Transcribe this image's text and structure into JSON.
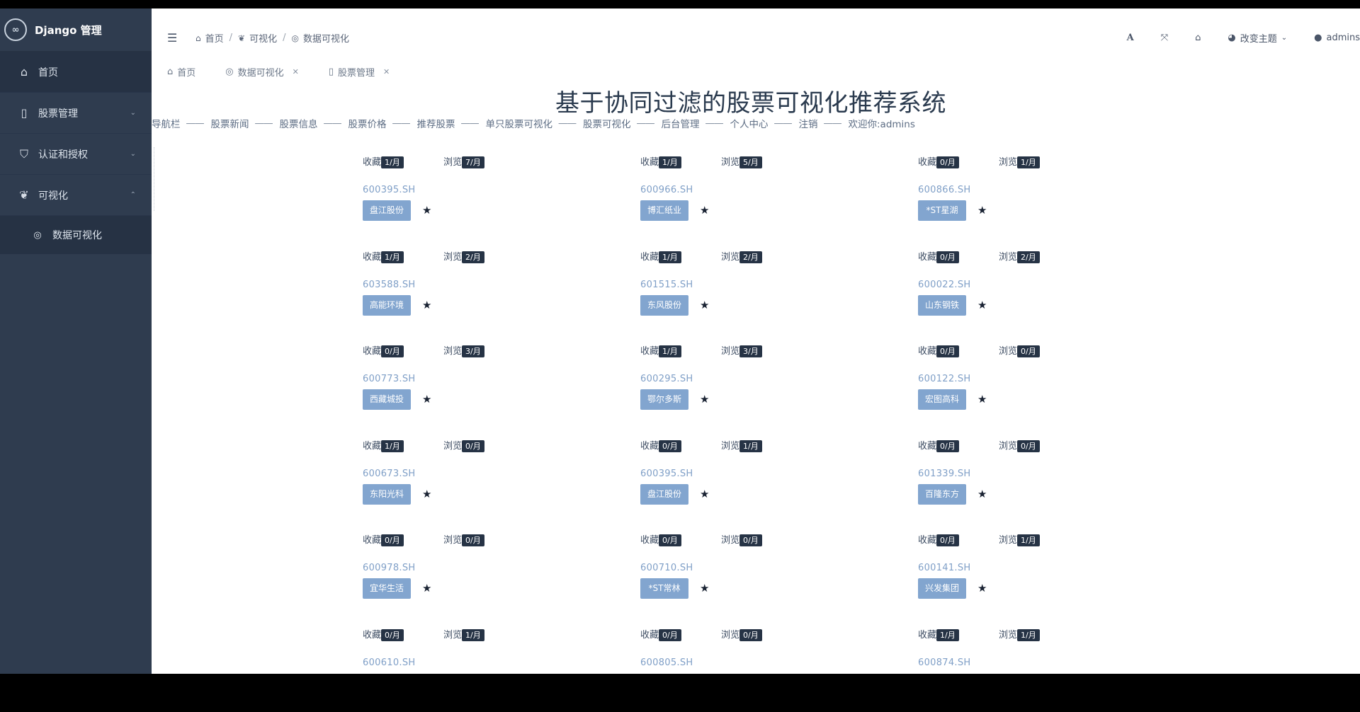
{
  "app": {
    "title": "Django 管理",
    "logo_glyph": "∞"
  },
  "sidebar": {
    "items": [
      {
        "label": "首页",
        "icon": "home-icon"
      },
      {
        "label": "股票管理",
        "icon": "file-icon"
      },
      {
        "label": "认证和授权",
        "icon": "shield-icon"
      },
      {
        "label": "可视化",
        "icon": "leaf-icon"
      }
    ],
    "sub_items": [
      {
        "label": "数据可视化",
        "icon": "dashboard-icon"
      }
    ]
  },
  "header": {
    "breadcrumb": [
      "首页",
      "可视化",
      "数据可视化"
    ],
    "theme_label": "改变主题",
    "user_label": "admins"
  },
  "tabs": [
    {
      "label": "首页"
    },
    {
      "label": "数据可视化"
    },
    {
      "label": "股票管理"
    }
  ],
  "main": {
    "title": "基于协同过滤的股票可视化推荐系统",
    "nav": [
      "导航栏",
      "股票新闻",
      "股票信息",
      "股票价格",
      "推荐股票",
      "单只股票可视化",
      "股票可视化",
      "后台管理",
      "个人中心",
      "注销",
      "欢迎你:admins"
    ],
    "nav_dash": "一一",
    "collect_label": "收藏",
    "browse_label": "浏览"
  },
  "stocks": [
    {
      "code": "600395.SH",
      "name": "盘江股份",
      "collect": "1/月",
      "browse": "7/月"
    },
    {
      "code": "600966.SH",
      "name": "博汇纸业",
      "collect": "1/月",
      "browse": "5/月"
    },
    {
      "code": "600866.SH",
      "name": "*ST星湖",
      "collect": "0/月",
      "browse": "1/月"
    },
    {
      "code": "603588.SH",
      "name": "高能环境",
      "collect": "1/月",
      "browse": "2/月"
    },
    {
      "code": "601515.SH",
      "name": "东风股份",
      "collect": "1/月",
      "browse": "2/月"
    },
    {
      "code": "600022.SH",
      "name": "山东钢铁",
      "collect": "0/月",
      "browse": "2/月"
    },
    {
      "code": "600773.SH",
      "name": "西藏城投",
      "collect": "0/月",
      "browse": "3/月"
    },
    {
      "code": "600295.SH",
      "name": "鄂尔多斯",
      "collect": "1/月",
      "browse": "3/月"
    },
    {
      "code": "600122.SH",
      "name": "宏图高科",
      "collect": "0/月",
      "browse": "0/月"
    },
    {
      "code": "600673.SH",
      "name": "东阳光科",
      "collect": "1/月",
      "browse": "0/月"
    },
    {
      "code": "600395.SH",
      "name": "盘江股份",
      "collect": "0/月",
      "browse": "1/月"
    },
    {
      "code": "601339.SH",
      "name": "百隆东方",
      "collect": "0/月",
      "browse": "0/月"
    },
    {
      "code": "600978.SH",
      "name": "宜华生活",
      "collect": "0/月",
      "browse": "0/月"
    },
    {
      "code": "600710.SH",
      "name": "*ST常林",
      "collect": "0/月",
      "browse": "0/月"
    },
    {
      "code": "600141.SH",
      "name": "兴发集团",
      "collect": "0/月",
      "browse": "1/月"
    },
    {
      "code": "600610.SH",
      "name": "",
      "collect": "0/月",
      "browse": "1/月"
    },
    {
      "code": "600805.SH",
      "name": "",
      "collect": "0/月",
      "browse": "0/月"
    },
    {
      "code": "600874.SH",
      "name": "",
      "collect": "1/月",
      "browse": "1/月"
    }
  ],
  "colors": {
    "sidebar_bg": "#2f3c4f",
    "badge_bg": "#263345",
    "name_btn_bg": "#82a5cf",
    "code_text": "#7f9fc7"
  }
}
